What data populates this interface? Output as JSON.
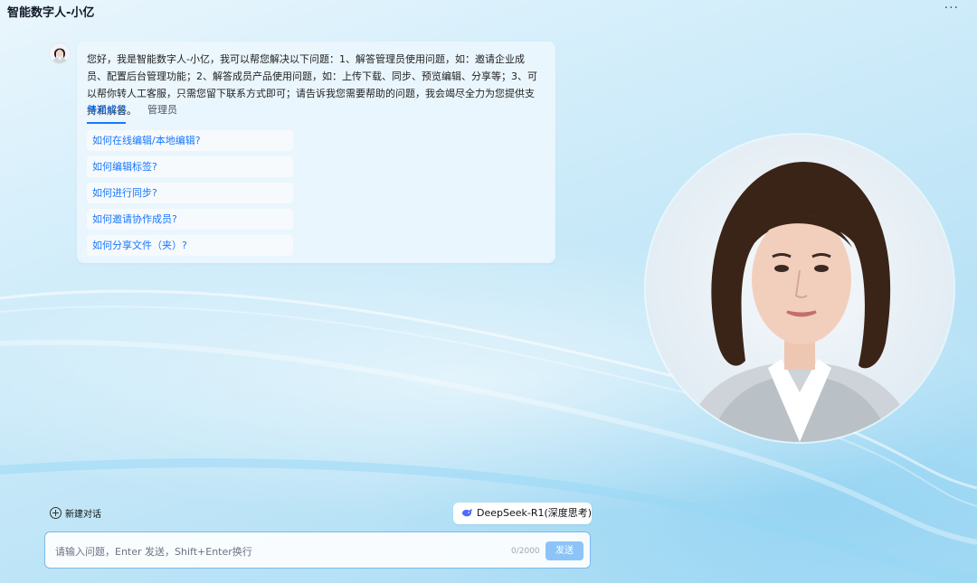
{
  "app": {
    "title": "智能数字人-小亿",
    "more_label": "···"
  },
  "chat": {
    "intro": "您好，我是智能数字人-小亿，我可以帮您解决以下问题：1、解答管理员使用问题，如：邀请企业成员、配置后台管理功能；2、解答成员产品使用问题，如：上传下载、同步、预览编辑、分享等；3、可以帮你转人工客服，只需您留下联系方式即可；请告诉我您需要帮助的问题，我会竭尽全力为您提供支持和解答。",
    "tabs": [
      {
        "label": "普通成员",
        "active": true
      },
      {
        "label": "管理员",
        "active": false
      }
    ],
    "questions": [
      "如何在线编辑/本地编辑?",
      "如何编辑标签?",
      "如何进行同步?",
      "如何邀请协作成员?",
      "如何分享文件（夹）?"
    ]
  },
  "composer": {
    "new_chat": "新建对话",
    "model_label": "DeepSeek-R1(深度思考)",
    "placeholder": "请输入问题，Enter 发送，Shift+Enter换行",
    "counter": "0/2000",
    "send": "发送"
  },
  "colors": {
    "accent": "#1677ff",
    "send_button": "#8cc4f7",
    "input_border": "#7cb8f0"
  },
  "icons": {
    "new_chat": "plus-circle-icon",
    "model": "deepseek-whale-icon",
    "more": "more-dots-icon"
  }
}
